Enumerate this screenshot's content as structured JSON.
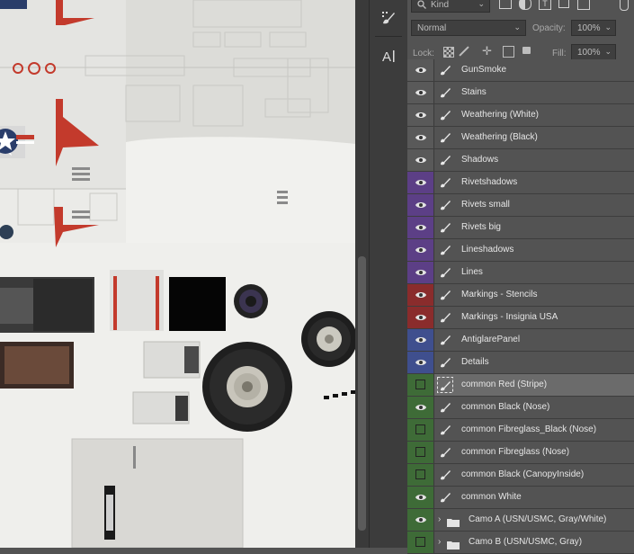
{
  "colors": {
    "gray": "#595959",
    "purple": "#5c3f86",
    "red": "#8a2c2c",
    "blue": "#3f4f8e",
    "green": "#3e6b37"
  },
  "filters": {
    "kind_label": "Kind",
    "blend_mode": "Normal",
    "opacity_label": "Opacity:",
    "opacity_value": "100%",
    "lock_label": "Lock:",
    "fill_label": "Fill:",
    "fill_value": "100%"
  },
  "tools": {
    "brush_icon": "brush-presets-icon",
    "text_icon": "character-icon"
  },
  "layers": [
    {
      "name": "GunSmoke",
      "color": "gray",
      "visible": true,
      "type": "layer"
    },
    {
      "name": "Stains",
      "color": "gray",
      "visible": true,
      "type": "layer"
    },
    {
      "name": "Weathering (White)",
      "color": "gray",
      "visible": true,
      "type": "layer"
    },
    {
      "name": "Weathering (Black)",
      "color": "gray",
      "visible": true,
      "type": "layer"
    },
    {
      "name": "Shadows",
      "color": "gray",
      "visible": true,
      "type": "layer"
    },
    {
      "name": "Rivetshadows",
      "color": "purple",
      "visible": true,
      "type": "layer"
    },
    {
      "name": "Rivets small",
      "color": "purple",
      "visible": true,
      "type": "layer"
    },
    {
      "name": "Rivets big",
      "color": "purple",
      "visible": true,
      "type": "layer"
    },
    {
      "name": "Lineshadows",
      "color": "purple",
      "visible": true,
      "type": "layer"
    },
    {
      "name": "Lines",
      "color": "purple",
      "visible": true,
      "type": "layer"
    },
    {
      "name": "Markings - Stencils",
      "color": "red",
      "visible": true,
      "type": "layer"
    },
    {
      "name": "Markings - Insignia USA",
      "color": "red",
      "visible": true,
      "type": "layer"
    },
    {
      "name": "AntiglarePanel",
      "color": "blue",
      "visible": true,
      "type": "layer"
    },
    {
      "name": "Details",
      "color": "blue",
      "visible": true,
      "type": "layer"
    },
    {
      "name": "common Red (Stripe)",
      "color": "green",
      "visible": false,
      "type": "layer",
      "active": true
    },
    {
      "name": "common Black (Nose)",
      "color": "green",
      "visible": true,
      "type": "layer"
    },
    {
      "name": "common Fibreglass_Black (Nose)",
      "color": "green",
      "visible": false,
      "type": "layer"
    },
    {
      "name": "common Fibreglass (Nose)",
      "color": "green",
      "visible": false,
      "type": "layer"
    },
    {
      "name": "common Black (CanopyInside)",
      "color": "green",
      "visible": false,
      "type": "layer"
    },
    {
      "name": "common White",
      "color": "green",
      "visible": true,
      "type": "layer"
    },
    {
      "name": "Camo A (USN/USMC, Gray/White)",
      "color": "green",
      "visible": true,
      "type": "folder"
    },
    {
      "name": "Camo B (USN/USMC, Gray)",
      "color": "green",
      "visible": false,
      "type": "folder"
    }
  ]
}
